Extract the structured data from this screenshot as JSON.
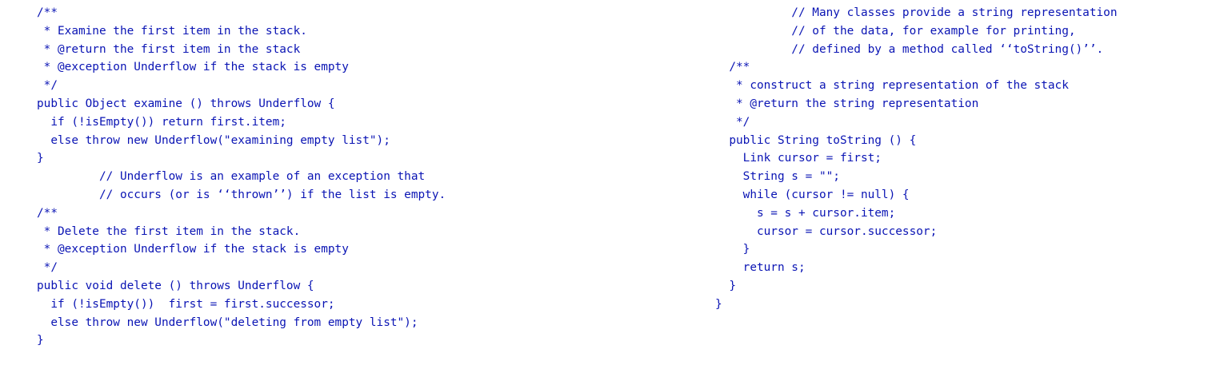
{
  "left_column": {
    "lines": [
      "/**",
      " * Examine the first item in the stack.",
      " * @return the first item in the stack",
      " * @exception Underflow if the stack is empty",
      " */",
      "public Object examine () throws Underflow {",
      "  if (!isEmpty()) return first.item;",
      "  else throw new Underflow(\"examining empty list\");",
      "}",
      "         // Underflow is an example of an exception that",
      "         // occurs (or is ‘‘thrown’’) if the list is empty.",
      "/**",
      " * Delete the first item in the stack.",
      " * @exception Underflow if the stack is empty",
      " */",
      "public void delete () throws Underflow {",
      "  if (!isEmpty())  first = first.successor;",
      "  else throw new Underflow(\"deleting from empty list\");",
      "}"
    ]
  },
  "right_column": {
    "lines": [
      "           // Many classes provide a string representation",
      "           // of the data, for example for printing,",
      "           // defined by a method called ‘‘toString()’’.",
      "  /**",
      "   * construct a string representation of the stack",
      "   * @return the string representation",
      "   */",
      "  public String toString () {",
      "    Link cursor = first;",
      "    String s = \"\";",
      "    while (cursor != null) {",
      "      s = s + cursor.item;",
      "      cursor = cursor.successor;",
      "    }",
      "    return s;",
      "  }",
      "}"
    ]
  },
  "colors": {
    "code_text": "#0a14b4",
    "background": "#ffffff"
  }
}
